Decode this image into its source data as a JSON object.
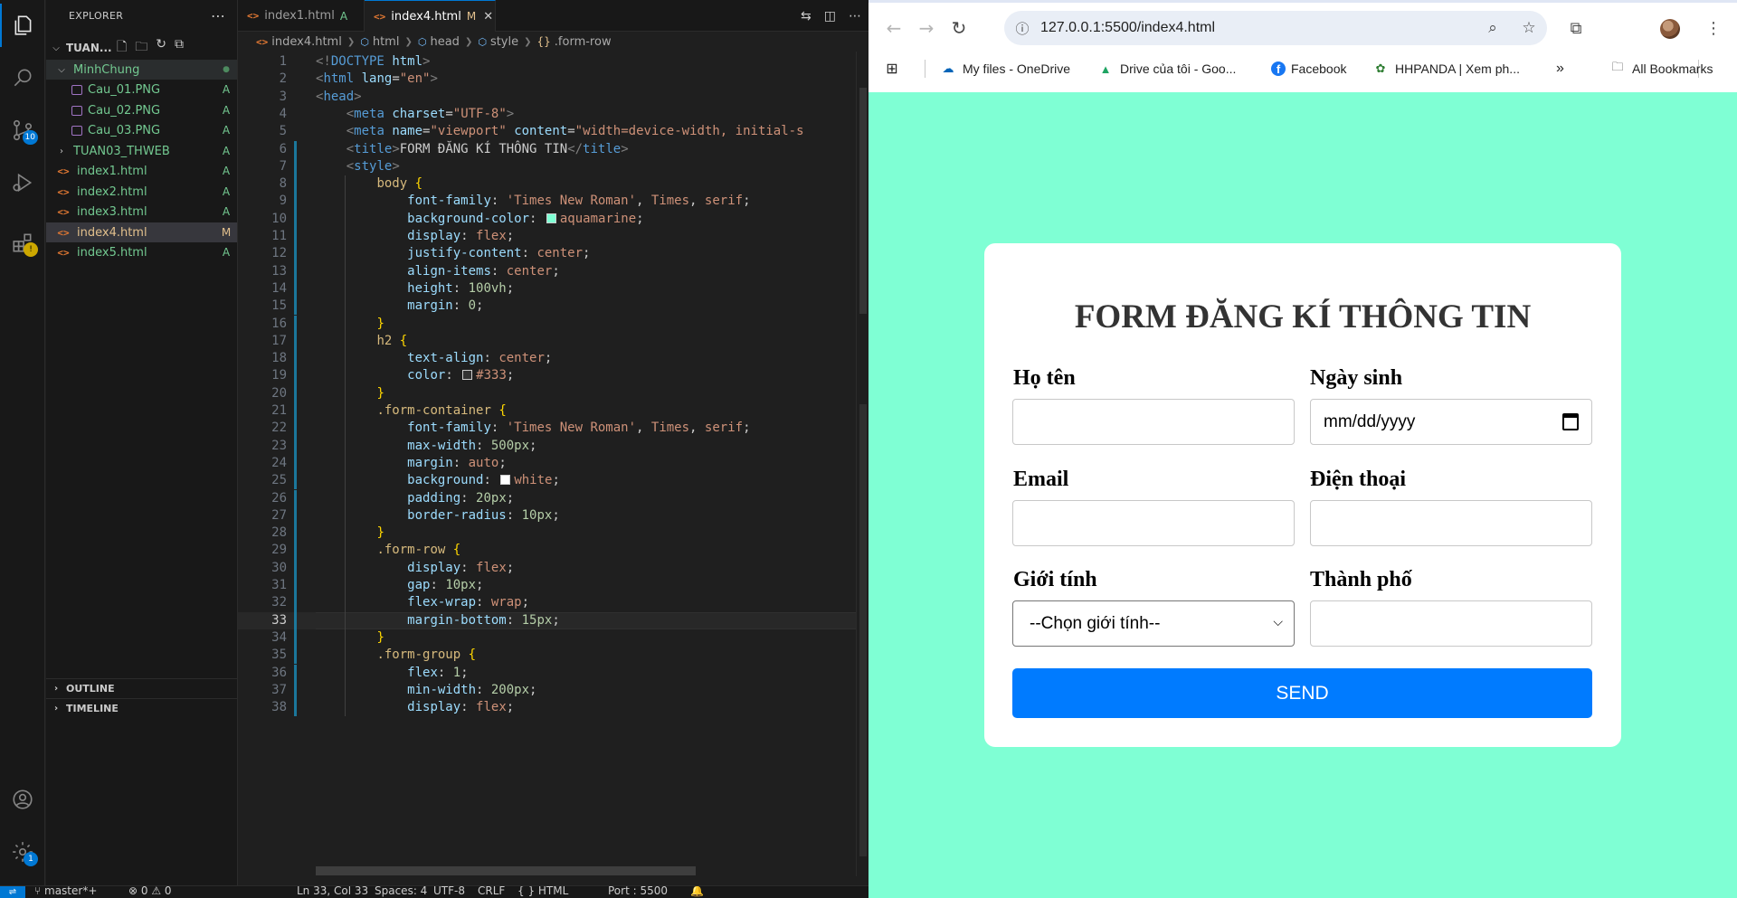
{
  "vscode": {
    "explorer_title": "EXPLORER",
    "workspace": "TUAN...",
    "tree": [
      {
        "label": "MinhChung",
        "status": "●",
        "kind": "folder-open"
      },
      {
        "label": "Cau_01.PNG",
        "status": "A",
        "kind": "image"
      },
      {
        "label": "Cau_02.PNG",
        "status": "A",
        "kind": "image"
      },
      {
        "label": "Cau_03.PNG",
        "status": "A",
        "kind": "image"
      },
      {
        "label": "TUAN03_THWEB",
        "status": "A",
        "kind": "folder"
      },
      {
        "label": "index1.html",
        "status": "A",
        "kind": "html"
      },
      {
        "label": "index2.html",
        "status": "A",
        "kind": "html"
      },
      {
        "label": "index3.html",
        "status": "A",
        "kind": "html"
      },
      {
        "label": "index4.html",
        "status": "M",
        "kind": "html"
      },
      {
        "label": "index5.html",
        "status": "A",
        "kind": "html"
      }
    ],
    "outline": "OUTLINE",
    "timeline": "TIMELINE",
    "activity_badges": {
      "scm": "10",
      "extensions": "!",
      "settings": "1"
    },
    "tabs": [
      {
        "label": "index1.html",
        "status": "A"
      },
      {
        "label": "index4.html",
        "status": "M"
      }
    ],
    "breadcrumb": [
      "index4.html",
      "html",
      "head",
      "style",
      ".form-row"
    ],
    "current_line": 33,
    "statusbar": {
      "branch": "master*+",
      "problems": "⊗ 0 ⚠ 0",
      "position": "Ln 33, Col 33",
      "spaces": "Spaces: 4",
      "encoding": "UTF-8",
      "eol": "CRLF",
      "language": "{ } HTML",
      "port": "Port : 5500"
    }
  },
  "browser": {
    "url": "127.0.0.1:5500/index4.html",
    "bookmarks": [
      {
        "label": "My files - OneDrive",
        "icon": "onedrive-icon"
      },
      {
        "label": "Drive của tôi - Goo...",
        "icon": "google-drive-icon"
      },
      {
        "label": "Facebook",
        "icon": "facebook-icon"
      },
      {
        "label": "HHPANDA | Xem ph...",
        "icon": "hhpanda-icon"
      }
    ],
    "all_bookmarks": "All Bookmarks",
    "page": {
      "background": "#7fffd4",
      "title": "FORM ĐĂNG KÍ THÔNG TIN",
      "labels": {
        "name": "Họ tên",
        "birthday": "Ngày sinh",
        "email": "Email",
        "phone": "Điện thoại",
        "gender": "Giới tính",
        "city": "Thành phố"
      },
      "date_placeholder": "mm/dd/yyyy",
      "gender_selected": "--Chọn giới tính--",
      "send_label": "SEND",
      "send_color": "#007bff"
    }
  }
}
